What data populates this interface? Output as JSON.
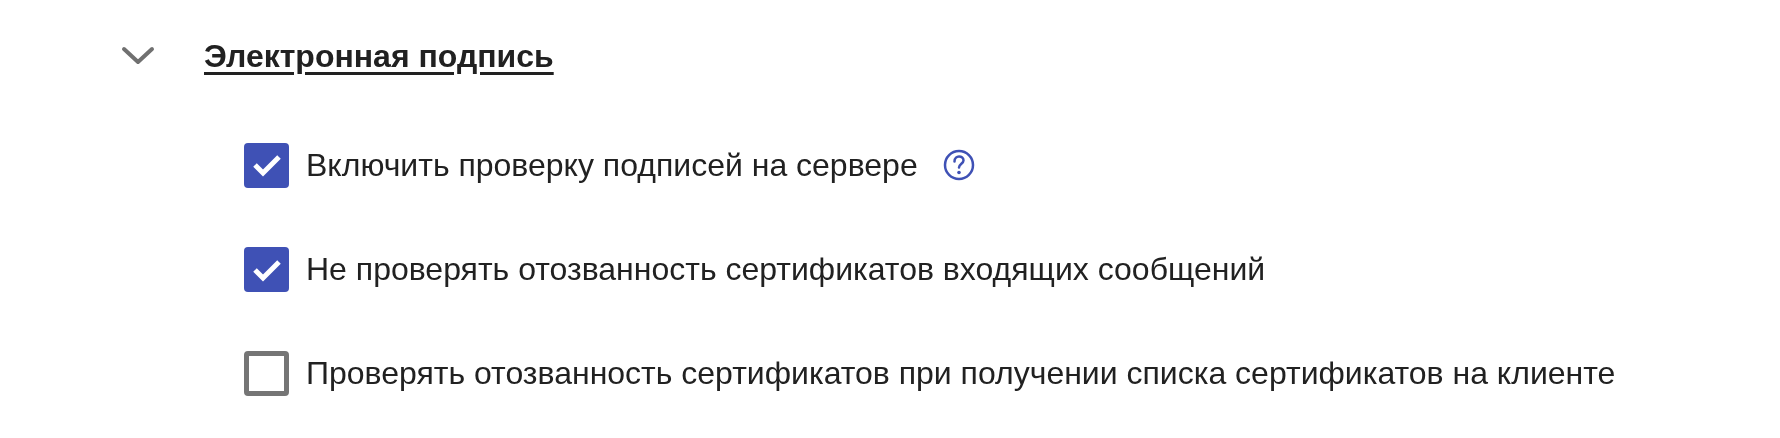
{
  "section": {
    "title": "Электронная подпись",
    "expanded": true,
    "options": [
      {
        "label": "Включить проверку подписей на сервере",
        "checked": true,
        "help": true
      },
      {
        "label": "Не проверять отозванность сертификатов входящих сообщений",
        "checked": true,
        "help": false
      },
      {
        "label": "Проверять отозванность сертификатов при получении списка сертификатов на клиенте",
        "checked": false,
        "help": false
      }
    ]
  }
}
